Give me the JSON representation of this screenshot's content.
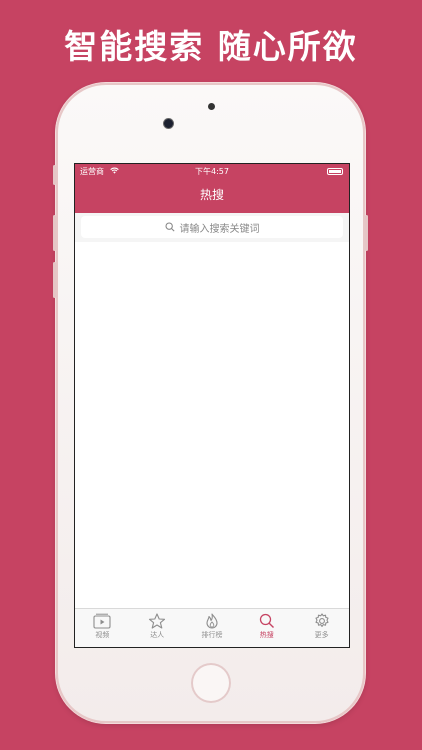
{
  "headline": "智能搜索 随心所欲",
  "status_bar": {
    "carrier": "运营商",
    "time": "下午4:57"
  },
  "nav": {
    "title": "热搜"
  },
  "search": {
    "placeholder": "请输入搜索关键词"
  },
  "tabs": [
    {
      "label": "视频",
      "icon": "video-icon",
      "active": false
    },
    {
      "label": "达人",
      "icon": "star-icon",
      "active": false
    },
    {
      "label": "排行榜",
      "icon": "flame-icon",
      "active": false
    },
    {
      "label": "热搜",
      "icon": "search-icon",
      "active": true
    },
    {
      "label": "更多",
      "icon": "gear-icon",
      "active": false
    }
  ],
  "colors": {
    "accent": "#c64362",
    "tab_inactive": "#8e8e8e"
  }
}
